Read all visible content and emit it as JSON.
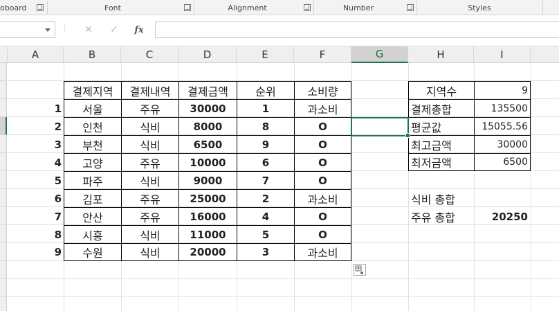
{
  "ribbon": {
    "groups": [
      {
        "label": "oboard"
      },
      {
        "label": "Font"
      },
      {
        "label": "Alignment"
      },
      {
        "label": "Number"
      },
      {
        "label": "Styles"
      }
    ]
  },
  "formula_bar": {
    "name_box_value": "",
    "cancel_glyph": "✕",
    "enter_glyph": "✓",
    "fx_label": "fx",
    "formula_value": ""
  },
  "columns": [
    "A",
    "B",
    "C",
    "D",
    "E",
    "F",
    "G",
    "H",
    "I"
  ],
  "selected_column": "G",
  "table": {
    "headers": [
      "결제지역",
      "결제내역",
      "결제금액",
      "순위",
      "소비량"
    ],
    "rows": [
      {
        "no": "1",
        "region": "서울",
        "type": "주유",
        "amount": "30000",
        "rank": "1",
        "usage": "과소비"
      },
      {
        "no": "2",
        "region": "인천",
        "type": "식비",
        "amount": "8000",
        "rank": "8",
        "usage": "O"
      },
      {
        "no": "3",
        "region": "부천",
        "type": "식비",
        "amount": "6500",
        "rank": "9",
        "usage": "O"
      },
      {
        "no": "4",
        "region": "고양",
        "type": "주유",
        "amount": "10000",
        "rank": "6",
        "usage": "O"
      },
      {
        "no": "5",
        "region": "파주",
        "type": "식비",
        "amount": "9000",
        "rank": "7",
        "usage": "O"
      },
      {
        "no": "6",
        "region": "김포",
        "type": "주유",
        "amount": "25000",
        "rank": "2",
        "usage": "과소비"
      },
      {
        "no": "7",
        "region": "안산",
        "type": "주유",
        "amount": "16000",
        "rank": "4",
        "usage": "O"
      },
      {
        "no": "8",
        "region": "시흥",
        "type": "식비",
        "amount": "11000",
        "rank": "5",
        "usage": "O"
      },
      {
        "no": "9",
        "region": "수원",
        "type": "식비",
        "amount": "20000",
        "rank": "3",
        "usage": "과소비"
      }
    ]
  },
  "summary": {
    "rows": [
      {
        "label": "지역수",
        "value": "9"
      },
      {
        "label": "결제총합",
        "value": "135500"
      },
      {
        "label": "평균값",
        "value": "15055.56"
      },
      {
        "label": "최고금액",
        "value": "30000"
      },
      {
        "label": "최저금액",
        "value": "6500"
      }
    ]
  },
  "extra": {
    "food_total_label": "식비 총합",
    "food_total_value": "",
    "fuel_total_label": "주유 총합",
    "fuel_total_value": "20250"
  },
  "colors": {
    "selection": "#217346",
    "gridline": "#e1e1e1",
    "header_bg": "#efefef"
  }
}
